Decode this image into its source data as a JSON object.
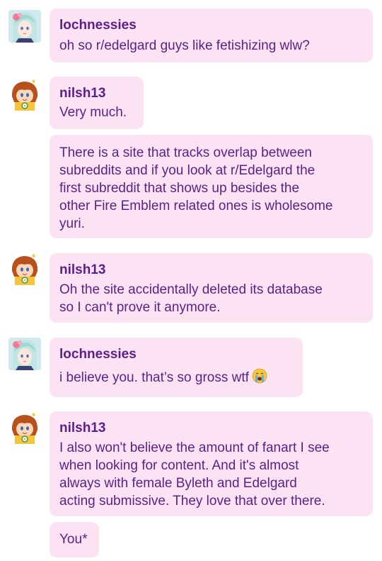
{
  "users": {
    "lochnessies": {
      "name": "lochnessies",
      "avatar_icon": "lochnessies-avatar-icon"
    },
    "nilsh13": {
      "name": "nilsh13",
      "avatar_icon": "daisy-avatar-icon"
    }
  },
  "messages": [
    {
      "author": "lochnessies",
      "lines": [
        "oh so r/edelgard guys like fetishizing wlw?"
      ]
    },
    {
      "author": "nilsh13",
      "lines": [
        "Very much."
      ]
    },
    {
      "author": "nilsh13",
      "lines": [
        "There is a site that tracks overlap between",
        "subreddits and if you look at r/Edelgard the",
        "first subreddit that shows up besides the",
        "other Fire Emblem related ones is wholesome",
        "yuri."
      ]
    },
    {
      "author": "nilsh13",
      "lines": [
        "Oh the site accidentally deleted its database",
        "so I can't prove it anymore."
      ]
    },
    {
      "author": "lochnessies",
      "lines": [
        "i believe you. that’s so gross wtf"
      ],
      "emoji": "loudly-crying-face-icon"
    },
    {
      "author": "nilsh13",
      "lines": [
        "I also won't believe the amount of fanart I see",
        "when looking for content. And it's almost",
        "always with female Byleth and Edelgard",
        "acting submissive. They love that over there."
      ]
    },
    {
      "author": "nilsh13",
      "lines": [
        "You*"
      ]
    }
  ],
  "colors": {
    "bubble": "#fbe3f4",
    "text": "#5a1f8a"
  }
}
